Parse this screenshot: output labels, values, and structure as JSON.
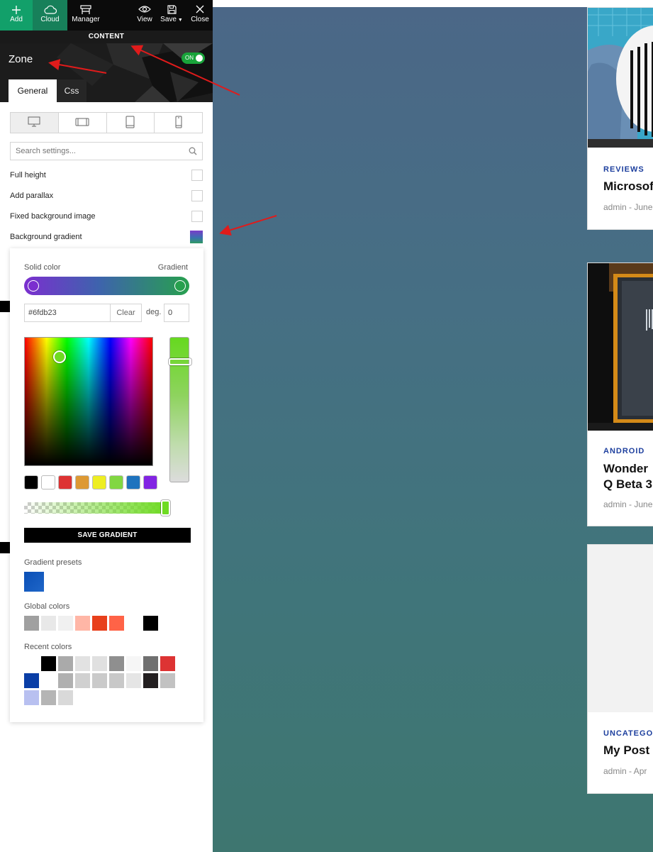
{
  "toolbar": {
    "add_label": "Add",
    "cloud_label": "Cloud",
    "manager_label": "Manager",
    "view_label": "View",
    "save_label": "Save",
    "close_label": "Close"
  },
  "content_bar": {
    "label": "CONTENT"
  },
  "zone": {
    "title": "Zone",
    "toggle_label": "ON"
  },
  "tabs": {
    "general": "General",
    "css": "Css"
  },
  "search": {
    "placeholder": "Search settings..."
  },
  "options": {
    "full_height": "Full height",
    "add_parallax": "Add parallax",
    "fixed_bg": "Fixed background image",
    "bg_gradient": "Background gradient"
  },
  "picker": {
    "solid_label": "Solid color",
    "gradient_label": "Gradient",
    "hex_value": "#6fdb23",
    "clear_label": "Clear",
    "deg_label": "deg.",
    "deg_value": "0",
    "save_gradient_label": "SAVE GRADIENT",
    "presets_label": "Gradient presets",
    "global_label": "Global colors",
    "recent_label": "Recent colors",
    "swatches": [
      "#000000",
      "#ffffff",
      "#dd3333",
      "#dd9933",
      "#eeee22",
      "#81d742",
      "#1e73be",
      "#8224e3"
    ],
    "global_colors": [
      "#a0a0a0",
      "#e8e8e8",
      "#f0f0f0",
      "#ffb6a6",
      "#e8401c",
      "#ff6347",
      "#ffffff",
      "#000000"
    ],
    "recent_colors": [
      "#ffffff",
      "#000000",
      "#aaaaaa",
      "#e2e2e2",
      "#e0e0e0",
      "#8f8f8f",
      "#f6f6f6",
      "#707070",
      "#dd3333",
      "#0a3ea6",
      "#ffffff",
      "#b0b0b0",
      "#d0d0d0",
      "#cacaca",
      "#c8c8c8",
      "#e5e5e5",
      "#231f20",
      "#c2c2c2",
      "#b8c0f0",
      "#b5b5b5",
      "#d9d9d9"
    ]
  },
  "cards": [
    {
      "category": "REVIEWS",
      "title": "Microsof",
      "meta": "admin - June"
    },
    {
      "category": "ANDROID",
      "title": "Wonder",
      "title2": "Q Beta 3",
      "meta": "admin - June"
    },
    {
      "category": "UNCATEGO",
      "title": "My Post",
      "meta": "admin - Apr"
    }
  ]
}
